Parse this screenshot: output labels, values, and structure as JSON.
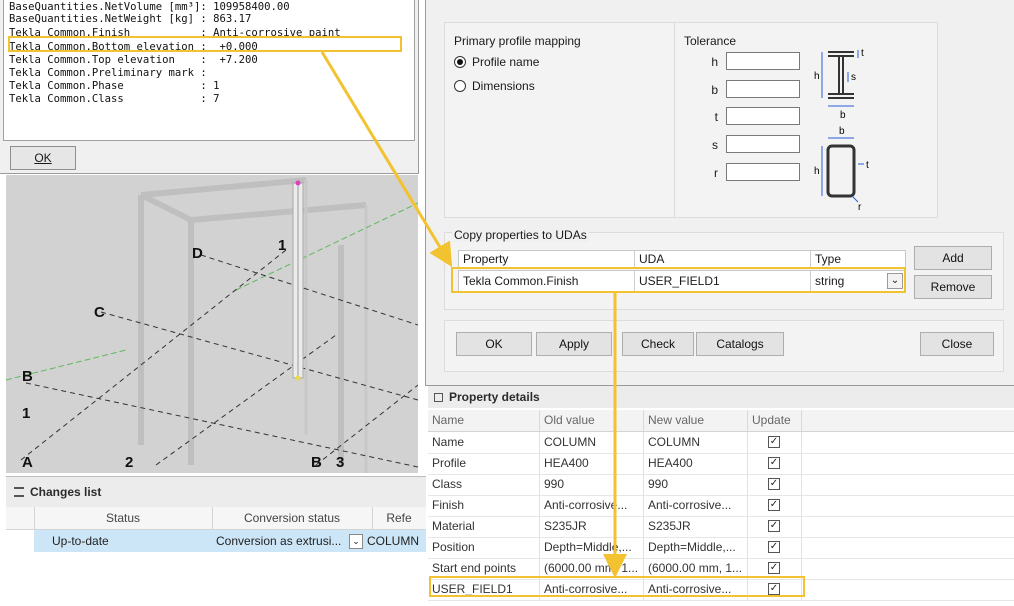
{
  "report": {
    "lines": [
      "BaseQuantities.NetVolume [mm³]: 109958400.00",
      "BaseQuantities.NetWeight [kg] : 863.17",
      "Tekla Common.Finish           : Anti-corrosive paint",
      "Tekla Common.Bottom elevation :  +0.000",
      "Tekla Common.Top elevation    :  +7.200",
      "Tekla Common.Preliminary mark :",
      "Tekla Common.Phase            : 1",
      "Tekla Common.Class            : 7"
    ],
    "ok_label": "OK"
  },
  "viewport": {
    "grid_labels": [
      "D",
      "1",
      "C",
      "B",
      "1",
      "A",
      "2",
      "B",
      "3"
    ]
  },
  "dialog": {
    "mapping_title": "Primary profile mapping",
    "opt_profile_name": "Profile name",
    "opt_dimensions": "Dimensions",
    "tolerance_title": "Tolerance",
    "tolerance_labels": [
      "h",
      "b",
      "t",
      "s",
      "r"
    ],
    "diagram_labels": {
      "h": "h",
      "b": "b",
      "t": "t",
      "s": "s",
      "r": "r"
    },
    "copy_title": "Copy properties to UDAs",
    "copy_headers": [
      "Property",
      "UDA",
      "Type"
    ],
    "copy_row": {
      "property": "Tekla Common.Finish",
      "uda": "USER_FIELD1",
      "type": "string"
    },
    "add_label": "Add",
    "remove_label": "Remove",
    "ok_label": "OK",
    "apply_label": "Apply",
    "check_label": "Check",
    "catalogs_label": "Catalogs",
    "close_label": "Close"
  },
  "props": {
    "title": "Property details",
    "headers": [
      "Name",
      "Old value",
      "New value",
      "Update"
    ],
    "rows": [
      {
        "name": "Name",
        "old": "COLUMN",
        "new": "COLUMN",
        "checked": true
      },
      {
        "name": "Profile",
        "old": "HEA400",
        "new": "HEA400",
        "checked": true
      },
      {
        "name": "Class",
        "old": "990",
        "new": "990",
        "checked": true
      },
      {
        "name": "Finish",
        "old": "Anti-corrosive...",
        "new": "Anti-corrosive...",
        "checked": true
      },
      {
        "name": "Material",
        "old": "S235JR",
        "new": "S235JR",
        "checked": true
      },
      {
        "name": "Position",
        "old": "Depth=Middle,...",
        "new": "Depth=Middle,...",
        "checked": true
      },
      {
        "name": "Start end points",
        "old": "(6000.00 mm, 1...",
        "new": "(6000.00 mm, 1...",
        "checked": true
      },
      {
        "name": "USER_FIELD1",
        "old": "Anti-corrosive...",
        "new": "Anti-corrosive...",
        "checked": true
      }
    ]
  },
  "changes": {
    "title": "Changes list",
    "headers": [
      "Status",
      "Conversion status",
      "Refe"
    ],
    "row": {
      "status": "Up-to-date",
      "conversion": "Conversion as extrusi...",
      "ref": "COLUMN"
    }
  },
  "colors": {
    "highlight": "#f2c230",
    "selection": "#cde6f7"
  }
}
